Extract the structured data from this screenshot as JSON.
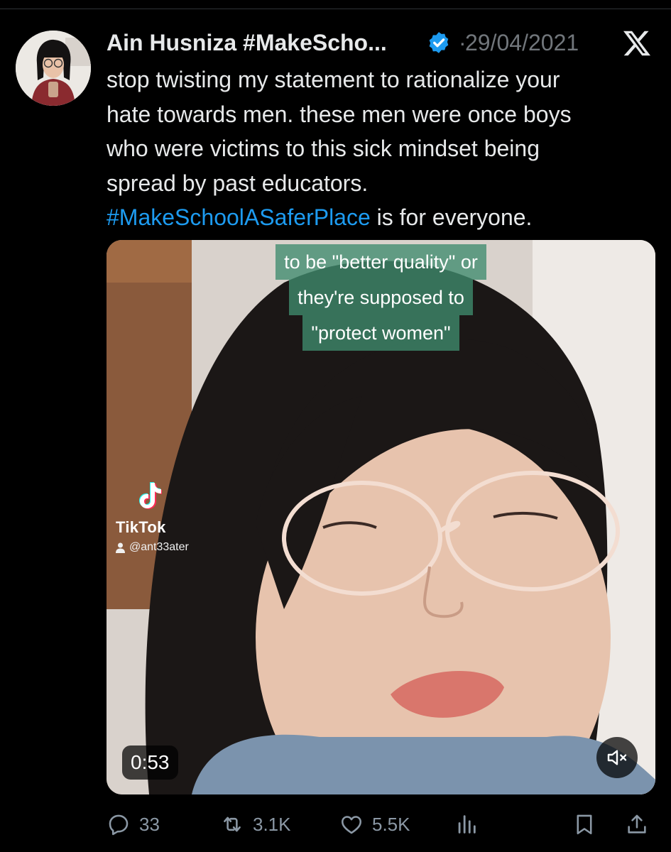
{
  "tweet": {
    "author_name": "Ain Husniza #MakeScho...",
    "separator": "·",
    "date": "29/04/2021",
    "text_lines": [
      "stop twisting my statement to rationalize your",
      "hate towards men. these men were once boys",
      "who were victims to this sick mindset being",
      "spread by past educators."
    ],
    "hashtag": "#MakeSchoolASaferPlace",
    "text_tail": " is for everyone."
  },
  "video": {
    "caption_lines": [
      "to be \"better quality\" or",
      "they're supposed to",
      "\"protect women\""
    ],
    "watermark_brand": "TikTok",
    "watermark_handle": "@ant33ater",
    "duration": "0:53"
  },
  "actions": {
    "replies": "33",
    "reposts": "3.1K",
    "likes": "5.5K"
  },
  "icons": {
    "verified": "verified-badge-icon",
    "logo": "x-logo-icon",
    "reply": "reply-icon",
    "repost": "repost-icon",
    "like": "heart-icon",
    "views": "views-icon",
    "bookmark": "bookmark-icon",
    "share": "share-icon",
    "mute": "mute-icon"
  },
  "colors": {
    "background": "#000000",
    "text": "#e7e9ea",
    "muted": "#71767b",
    "link": "#1d9bf0",
    "caption_bg": "#3f8c6e"
  }
}
